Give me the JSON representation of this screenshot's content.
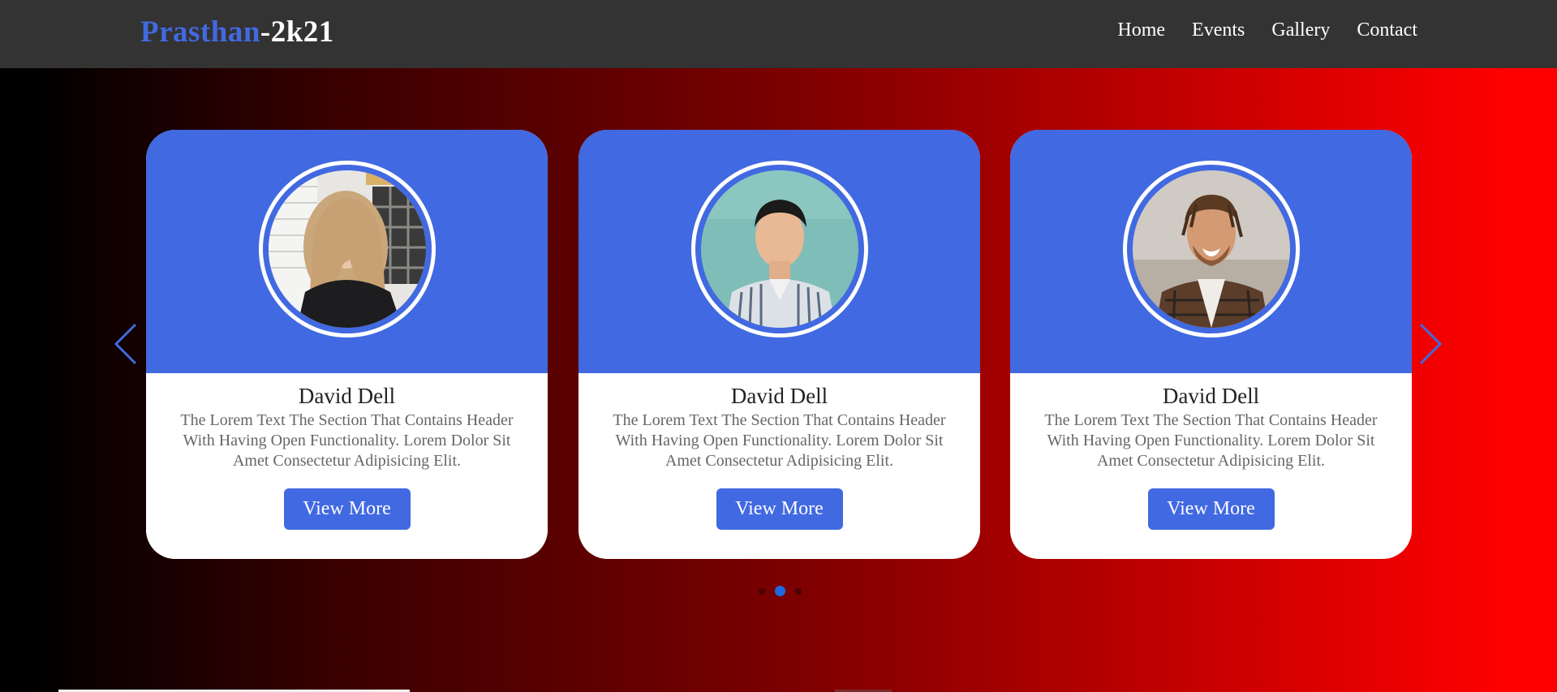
{
  "header": {
    "logo_brand": "Prasthan",
    "logo_year": "-2k21",
    "nav": [
      "Home",
      "Events",
      "Gallery",
      "Contact"
    ]
  },
  "cards": [
    {
      "name": "David Dell",
      "description": "The Lorem Text The Section That Contains Header With Having Open Functionality. Lorem Dolor Sit Amet Consectetur Adipisicing Elit.",
      "button": "View More",
      "photo": "woman-portrait"
    },
    {
      "name": "David Dell",
      "description": "The Lorem Text The Section That Contains Header With Having Open Functionality. Lorem Dolor Sit Amet Consectetur Adipisicing Elit.",
      "button": "View More",
      "photo": "man-portrait-teal-background"
    },
    {
      "name": "David Dell",
      "description": "The Lorem Text The Section That Contains Header With Having Open Functionality. Lorem Dolor Sit Amet Consectetur Adipisicing Elit.",
      "button": "View More",
      "photo": "man-portrait-plaid-shirt"
    }
  ],
  "carousel": {
    "prev_icon": "chevron-left-icon",
    "next_icon": "chevron-right-icon",
    "active_dot": 2,
    "dot_count": 3
  },
  "colors": {
    "accent": "#4169e1",
    "navbar": "#333333",
    "dot_active": "#1e6be0"
  }
}
